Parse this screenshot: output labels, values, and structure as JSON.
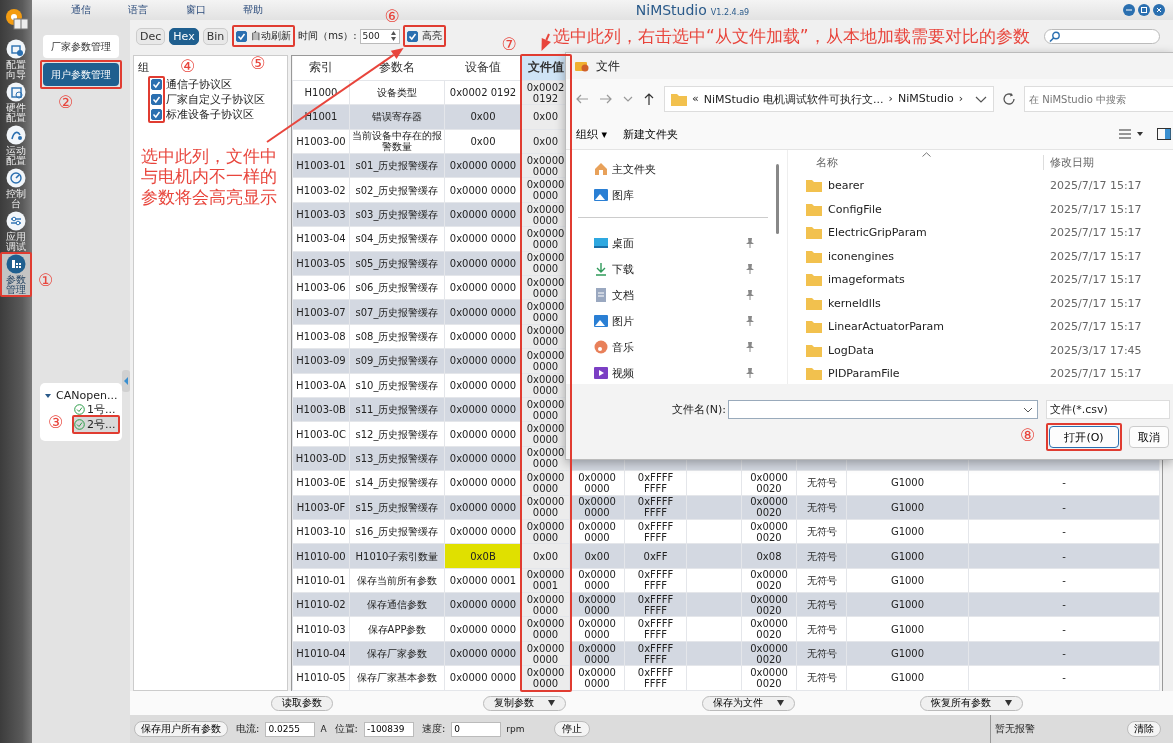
{
  "window": {
    "title": "NiMStudio",
    "version": "V1.2.4.a9"
  },
  "menu": [
    "通信",
    "语言",
    "窗口",
    "帮助"
  ],
  "nav": [
    {
      "label": "配置向导",
      "selected": false
    },
    {
      "label": "硬件配置",
      "selected": false
    },
    {
      "label": "运动配置",
      "selected": false
    },
    {
      "label": "控制台",
      "selected": false
    },
    {
      "label": "应用调试",
      "selected": false
    },
    {
      "label": "参数管理",
      "selected": true
    }
  ],
  "modes": [
    {
      "label": "厂家参数管理",
      "selected": false
    },
    {
      "label": "用户参数管理",
      "selected": true
    }
  ],
  "device_tree": {
    "label": "CANopen...",
    "expanded": true,
    "children": [
      {
        "label": "1号...",
        "selected": false
      },
      {
        "label": "2号...",
        "selected": true
      }
    ]
  },
  "toolbar": {
    "formats": [
      {
        "label": "Dec",
        "selected": false
      },
      {
        "label": "Hex",
        "selected": true
      },
      {
        "label": "Bin",
        "selected": false
      }
    ],
    "auto_refresh": {
      "label": "自动刷新",
      "checked": true
    },
    "interval": {
      "label": "时间（ms）:",
      "value": "500"
    },
    "highlight": {
      "label": "高亮",
      "checked": true
    }
  },
  "groups": {
    "title": "组",
    "items": [
      {
        "label": "通信子协议区",
        "checked": true
      },
      {
        "label": "厂家自定义子协议区",
        "checked": true
      },
      {
        "label": "标准设备子协议区",
        "checked": true
      }
    ]
  },
  "table": {
    "columns": [
      "索引",
      "参数名",
      "设备值",
      "文件值"
    ],
    "rows": [
      {
        "index": "H1000",
        "name": "设备类型",
        "device_value": "0x0002 0192",
        "file_value": "0x0002 0192",
        "highlighted": false
      },
      {
        "index": "H1001",
        "name": "错误寄存器",
        "device_value": "0x00",
        "file_value": "0x00",
        "highlighted": false
      },
      {
        "index": "H1003-00",
        "name": "当前设备中存在的报警数量",
        "device_value": "0x00",
        "file_value": "0x00",
        "highlighted": false
      },
      {
        "index": "H1003-01",
        "name": "s01_历史报警缓存",
        "device_value": "0x0000 0000",
        "file_value": "0x0000 0000",
        "highlighted": false
      },
      {
        "index": "H1003-02",
        "name": "s02_历史报警缓存",
        "device_value": "0x0000 0000",
        "file_value": "0x0000 0000",
        "highlighted": false
      },
      {
        "index": "H1003-03",
        "name": "s03_历史报警缓存",
        "device_value": "0x0000 0000",
        "file_value": "0x0000 0000",
        "highlighted": false
      },
      {
        "index": "H1003-04",
        "name": "s04_历史报警缓存",
        "device_value": "0x0000 0000",
        "file_value": "0x0000 0000",
        "highlighted": false
      },
      {
        "index": "H1003-05",
        "name": "s05_历史报警缓存",
        "device_value": "0x0000 0000",
        "file_value": "0x0000 0000",
        "highlighted": false
      },
      {
        "index": "H1003-06",
        "name": "s06_历史报警缓存",
        "device_value": "0x0000 0000",
        "file_value": "0x0000 0000",
        "highlighted": false
      },
      {
        "index": "H1003-07",
        "name": "s07_历史报警缓存",
        "device_value": "0x0000 0000",
        "file_value": "0x0000 0000",
        "highlighted": false
      },
      {
        "index": "H1003-08",
        "name": "s08_历史报警缓存",
        "device_value": "0x0000 0000",
        "file_value": "0x0000 0000",
        "highlighted": false
      },
      {
        "index": "H1003-09",
        "name": "s09_历史报警缓存",
        "device_value": "0x0000 0000",
        "file_value": "0x0000 0000",
        "highlighted": false
      },
      {
        "index": "H1003-0A",
        "name": "s10_历史报警缓存",
        "device_value": "0x0000 0000",
        "file_value": "0x0000 0000",
        "highlighted": false
      },
      {
        "index": "H1003-0B",
        "name": "s11_历史报警缓存",
        "device_value": "0x0000 0000",
        "file_value": "0x0000 0000",
        "highlighted": false
      },
      {
        "index": "H1003-0C",
        "name": "s12_历史报警缓存",
        "device_value": "0x0000 0000",
        "file_value": "0x0000 0000",
        "highlighted": false
      },
      {
        "index": "H1003-0D",
        "name": "s13_历史报警缓存",
        "device_value": "0x0000 0000",
        "file_value": "0x0000 0000",
        "highlighted": false
      },
      {
        "index": "H1003-0E",
        "name": "s14_历史报警缓存",
        "device_value": "0x0000 0000",
        "file_value": "0x0000 0000",
        "highlighted": false,
        "rest": [
          "0x0000 0000",
          "0xFFFF FFFF",
          "0x0000 0020",
          "无符号",
          "G1000",
          "-"
        ]
      },
      {
        "index": "H1003-0F",
        "name": "s15_历史报警缓存",
        "device_value": "0x0000 0000",
        "file_value": "0x0000 0000",
        "highlighted": false,
        "rest": [
          "0x0000 0000",
          "0xFFFF FFFF",
          "0x0000 0020",
          "无符号",
          "G1000",
          "-"
        ]
      },
      {
        "index": "H1003-10",
        "name": "s16_历史报警缓存",
        "device_value": "0x0000 0000",
        "file_value": "0x0000 0000",
        "highlighted": false,
        "rest": [
          "0x0000 0000",
          "0xFFFF FFFF",
          "0x0000 0020",
          "无符号",
          "G1000",
          "-"
        ]
      },
      {
        "index": "H1010-00",
        "name": "H1010子索引数量",
        "device_value": "0x0B",
        "file_value": "0x00",
        "highlighted": true,
        "rest": [
          "0x00",
          "0xFF",
          "0x08",
          "无符号",
          "G1000",
          "-"
        ]
      },
      {
        "index": "H1010-01",
        "name": "保存当前所有参数",
        "device_value": "0x0000 0001",
        "file_value": "0x0000 0001",
        "highlighted": false,
        "rest": [
          "0x0000 0000",
          "0xFFFF FFFF",
          "0x0000 0020",
          "无符号",
          "G1000",
          "-"
        ]
      },
      {
        "index": "H1010-02",
        "name": "保存通信参数",
        "device_value": "0x0000 0000",
        "file_value": "0x0000 0000",
        "highlighted": false,
        "rest": [
          "0x0000 0000",
          "0xFFFF FFFF",
          "0x0000 0020",
          "无符号",
          "G1000",
          "-"
        ]
      },
      {
        "index": "H1010-03",
        "name": "保存APP参数",
        "device_value": "0x0000 0000",
        "file_value": "0x0000 0000",
        "highlighted": false,
        "rest": [
          "0x0000 0000",
          "0xFFFF FFFF",
          "0x0000 0020",
          "无符号",
          "G1000",
          "-"
        ]
      },
      {
        "index": "H1010-04",
        "name": "保存厂家参数",
        "device_value": "0x0000 0000",
        "file_value": "0x0000 0000",
        "highlighted": false,
        "rest": [
          "0x0000 0000",
          "0xFFFF FFFF",
          "0x0000 0020",
          "无符号",
          "G1000",
          "-"
        ]
      },
      {
        "index": "H1010-05",
        "name": "保存厂家基本参数",
        "device_value": "0x0000 0000",
        "file_value": "0x0000 0000",
        "highlighted": false,
        "rest": [
          "0x0000 0000",
          "0xFFFF FFFF",
          "0x0000 0020",
          "无符号",
          "G1000",
          "-"
        ]
      }
    ]
  },
  "actions": [
    {
      "label": "读取参数",
      "has_menu": false
    },
    {
      "label": "复制参数",
      "has_menu": true
    },
    {
      "label": "保存为文件",
      "has_menu": true
    },
    {
      "label": "恢复所有参数",
      "has_menu": true
    }
  ],
  "status_bar": {
    "save_button": "保存用户所有参数",
    "readouts": [
      {
        "label": "电流:",
        "value": "0.0255",
        "unit": "A"
      },
      {
        "label": "位置:",
        "value": "-100839"
      },
      {
        "label": "速度:",
        "value": "0",
        "unit": "rpm"
      }
    ],
    "stop_button": "停止",
    "message": "暂无报警",
    "clear_button": "清除"
  },
  "file_dialog": {
    "title": "文件",
    "path": [
      "«",
      "NiMStudio 电机调试软件可执行文...",
      "›",
      "NiMStudio",
      "›"
    ],
    "search_placeholder": "在 NiMStudio 中搜索",
    "commands": [
      "组织 ▾",
      "新建文件夹"
    ],
    "places": [
      {
        "label": "主文件夹",
        "kind": "home",
        "pinned": false
      },
      {
        "label": "图库",
        "kind": "gallery",
        "pinned": false
      },
      {
        "label": "桌面",
        "kind": "desktop",
        "pinned": true
      },
      {
        "label": "下载",
        "kind": "download",
        "pinned": true
      },
      {
        "label": "文档",
        "kind": "document",
        "pinned": true
      },
      {
        "label": "图片",
        "kind": "picture",
        "pinned": true
      },
      {
        "label": "音乐",
        "kind": "music",
        "pinned": true
      },
      {
        "label": "视频",
        "kind": "video",
        "pinned": true
      }
    ],
    "columns": [
      "名称",
      "修改日期"
    ],
    "files": [
      {
        "name": "bearer",
        "modified": "2025/7/17 15:17"
      },
      {
        "name": "ConfigFile",
        "modified": "2025/7/17 15:17"
      },
      {
        "name": "ElectricGripParam",
        "modified": "2025/7/17 15:17"
      },
      {
        "name": "iconengines",
        "modified": "2025/7/17 15:17"
      },
      {
        "name": "imageformats",
        "modified": "2025/7/17 15:17"
      },
      {
        "name": "kerneldlls",
        "modified": "2025/7/17 15:17"
      },
      {
        "name": "LinearActuatorParam",
        "modified": "2025/7/17 15:17"
      },
      {
        "name": "LogData",
        "modified": "2025/3/17 17:45"
      },
      {
        "name": "PIDParamFile",
        "modified": "2025/7/17 15:17"
      }
    ],
    "filename_label": "文件名(N):",
    "file_type": "文件(*.csv)",
    "buttons": [
      "打开(O)",
      "取消"
    ]
  },
  "annotations": {
    "markers": [
      "①",
      "②",
      "③",
      "④",
      "⑤",
      "⑥",
      "⑦",
      "⑧"
    ],
    "notes": [
      "选中此列，右击选中“从文件加载”，从本地加载需要对比的参数",
      "选中此列，文件中与电机内不一样的参数将会高亮显示"
    ]
  }
}
